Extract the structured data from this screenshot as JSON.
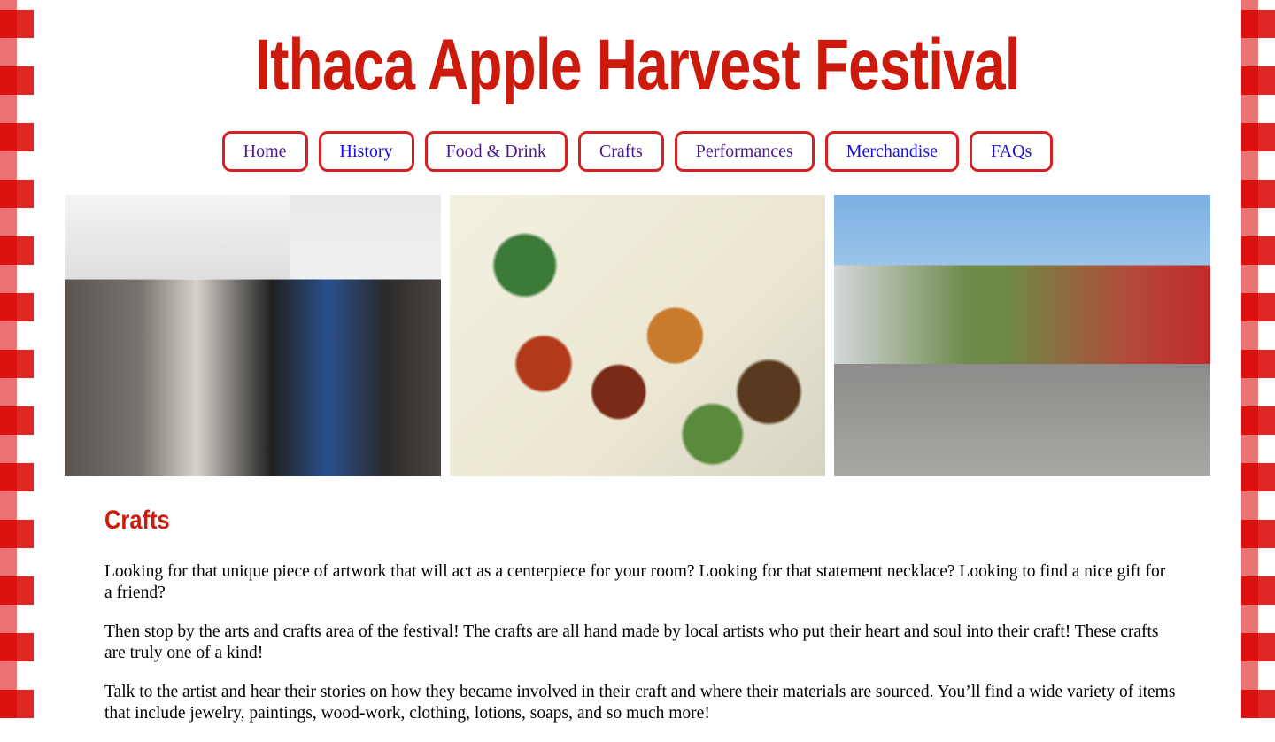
{
  "site": {
    "title": "Ithaca Apple Harvest Festival"
  },
  "nav": {
    "items": [
      {
        "label": "Home"
      },
      {
        "label": "History"
      },
      {
        "label": "Food & Drink"
      },
      {
        "label": "Crafts"
      },
      {
        "label": "Performances"
      },
      {
        "label": "Merchandise"
      },
      {
        "label": "FAQs"
      }
    ]
  },
  "main": {
    "heading": "Crafts",
    "paragraphs": [
      "Looking for that unique piece of artwork that will act as a centerpiece for your room? Looking for that statement necklace? Looking to find a nice gift for a friend?",
      "Then stop by the arts and crafts area of the festival! The crafts are all hand made by local artists who put their heart and soul into their craft! These crafts are truly one of a kind!",
      "Talk to the artist and hear their stories on how they became involved in their craft and where their materials are sourced. You’ll find a wide variety of items that include jewelry, paintings, wood-work, clothing, lotions, soaps, and so much more!"
    ]
  },
  "colors": {
    "accent": "#cc1a0c",
    "nav_border": "#d42222",
    "link_visited": "#4b1a8a",
    "link": "#1a10d8"
  }
}
